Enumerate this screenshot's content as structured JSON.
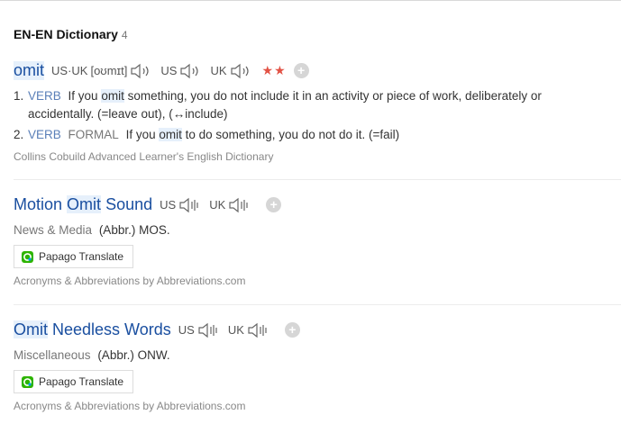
{
  "section": {
    "title": "EN-EN Dictionary",
    "count": "4"
  },
  "entry1": {
    "headword": "omit",
    "pron_us_uk_label": "US·UK",
    "ipa": "[oʊmɪt]",
    "us_label": "US",
    "uk_label": "UK",
    "stars": "★★",
    "plus": "+",
    "senses": [
      {
        "num": "1.",
        "pos": "VERB",
        "register": "",
        "pre": "If you",
        "hl": "omit",
        "post": "something, you do not include it in an activity or piece of work, deliberately or accidentally. (=leave out), (↔include)"
      },
      {
        "num": "2.",
        "pos": "VERB",
        "register": "FORMAL",
        "pre": "If you",
        "hl": "omit",
        "post": "to do something, you do not do it. (=fail)"
      }
    ],
    "source": "Collins Cobuild Advanced Learner's English Dictionary"
  },
  "entry2": {
    "hw_a": "Motion",
    "hw_hl": "Omit",
    "hw_b": "Sound",
    "us_label": "US",
    "uk_label": "UK",
    "plus": "+",
    "category": "News & Media",
    "abbr": "(Abbr.) MOS.",
    "translate_label": "Papago Translate",
    "source": "Acronyms & Abbreviations by Abbreviations.com"
  },
  "entry3": {
    "hw_hl": "Omit",
    "hw_b": "Needless Words",
    "us_label": "US",
    "uk_label": "UK",
    "plus": "+",
    "category": "Miscellaneous",
    "abbr": "(Abbr.) ONW.",
    "translate_label": "Papago Translate",
    "source": "Acronyms & Abbreviations by Abbreviations.com"
  },
  "colors": {
    "headword": "#1a4fa0",
    "highlight": "#e6f0fb",
    "stars": "#e25245",
    "pos": "#5a7fb8"
  },
  "icons": {
    "speaker": "speaker-icon",
    "plus": "plus-icon",
    "papago": "papago-logo-icon"
  }
}
